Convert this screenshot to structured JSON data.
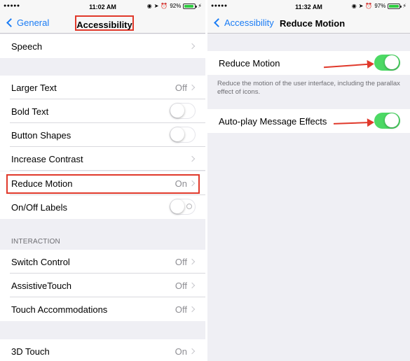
{
  "left": {
    "status": {
      "dots": "●●●●●",
      "carrier_signal": "wifi",
      "time": "11:02 AM",
      "battery_percent": "92%",
      "battery_level": 0.92
    },
    "nav": {
      "back_label": "General",
      "title": "Accessibility"
    },
    "rows": [
      {
        "label": "Speech",
        "value": ""
      },
      {
        "label": "Larger Text",
        "value": "Off"
      },
      {
        "label": "Bold Text",
        "toggle": "off"
      },
      {
        "label": "Button Shapes",
        "toggle": "off"
      },
      {
        "label": "Increase Contrast",
        "value": ""
      },
      {
        "label": "Reduce Motion",
        "value": "On"
      },
      {
        "label": "On/Off Labels",
        "toggle": "off"
      },
      {
        "label": "Switch Control",
        "value": "Off"
      },
      {
        "label": "AssistiveTouch",
        "value": "Off"
      },
      {
        "label": "Touch Accommodations",
        "value": "Off"
      },
      {
        "label": "3D Touch",
        "value": "On"
      }
    ],
    "section_interaction": "INTERACTION"
  },
  "right": {
    "status": {
      "dots": "●●●●●",
      "time": "11:32 AM",
      "battery_percent": "97%",
      "battery_level": 0.97
    },
    "nav": {
      "back_label": "Accessibility",
      "title": "Reduce Motion"
    },
    "rows": [
      {
        "label": "Reduce Motion",
        "toggle": "on"
      },
      {
        "label": "Auto-play Message Effects",
        "toggle": "on"
      }
    ],
    "footer": "Reduce the motion of the user interface, including the parallax effect of icons."
  },
  "colors": {
    "accent": "#1a7cf5",
    "toggle_on": "#4cd964",
    "annotation": "#e0392b",
    "background": "#efeff4"
  },
  "icons": [
    "wifi-icon",
    "location-icon",
    "alarm-icon",
    "battery-icon",
    "charging-icon",
    "chevron-left-icon",
    "chevron-right-icon"
  ]
}
